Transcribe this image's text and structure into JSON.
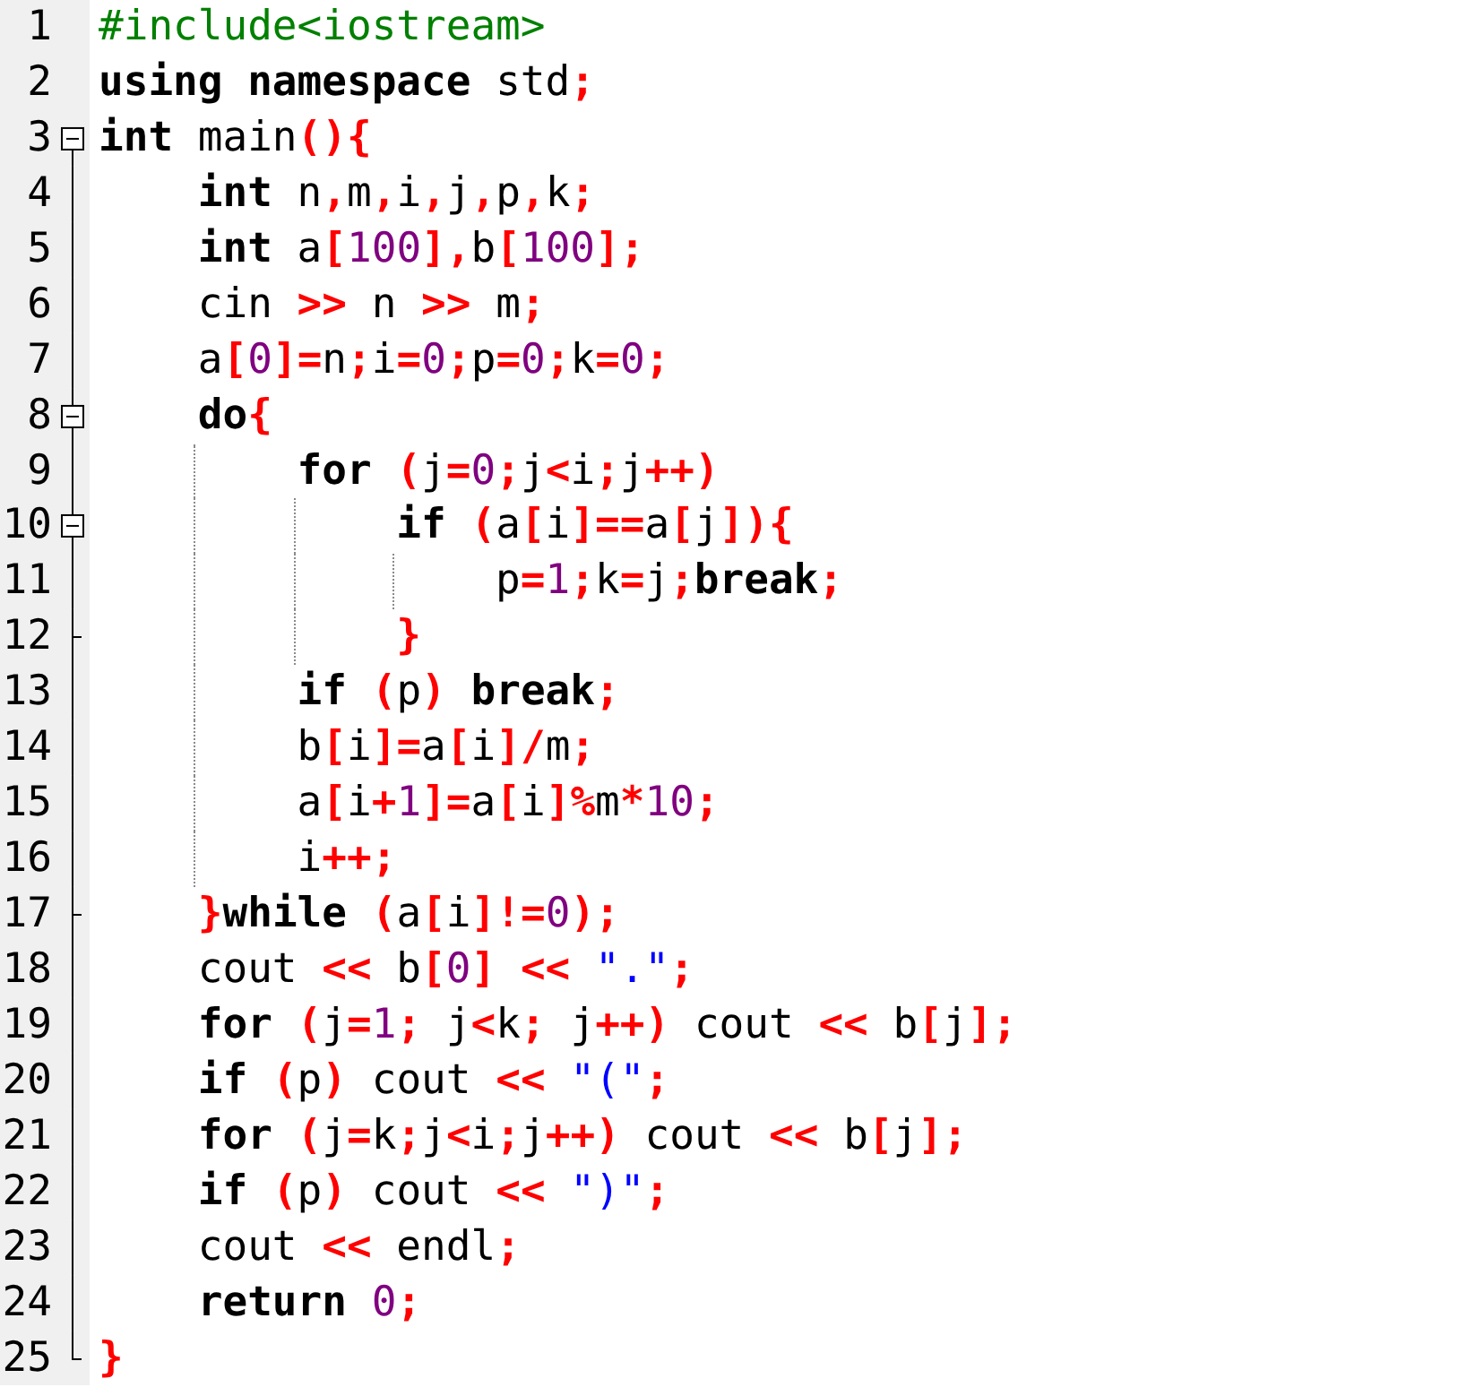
{
  "editor": {
    "lines": [
      {
        "number": "1",
        "kind": "plain",
        "tokens": [
          {
            "kind": "pre",
            "text": "#include<iostream>"
          }
        ]
      },
      {
        "number": "2",
        "kind": "plain",
        "tokens": [
          {
            "kind": "kw",
            "text": "using namespace"
          },
          {
            "kind": "plain",
            "text": " std"
          },
          {
            "kind": "op",
            "text": ";"
          }
        ]
      },
      {
        "number": "3",
        "kind": "open",
        "tokens": [
          {
            "kind": "kw",
            "text": "int"
          },
          {
            "kind": "plain",
            "text": " main"
          },
          {
            "kind": "op",
            "text": "(){"
          }
        ]
      },
      {
        "number": "4",
        "kind": "inner",
        "tokens": [
          {
            "kind": "kw",
            "text": "    int"
          },
          {
            "kind": "plain",
            "text": " n"
          },
          {
            "kind": "op",
            "text": ","
          },
          {
            "kind": "plain",
            "text": "m"
          },
          {
            "kind": "op",
            "text": ","
          },
          {
            "kind": "plain",
            "text": "i"
          },
          {
            "kind": "op",
            "text": ","
          },
          {
            "kind": "plain",
            "text": "j"
          },
          {
            "kind": "op",
            "text": ","
          },
          {
            "kind": "plain",
            "text": "p"
          },
          {
            "kind": "op",
            "text": ","
          },
          {
            "kind": "plain",
            "text": "k"
          },
          {
            "kind": "op",
            "text": ";"
          }
        ]
      },
      {
        "number": "5",
        "kind": "inner",
        "tokens": [
          {
            "kind": "kw",
            "text": "    int"
          },
          {
            "kind": "plain",
            "text": " a"
          },
          {
            "kind": "op",
            "text": "["
          },
          {
            "kind": "num",
            "text": "100"
          },
          {
            "kind": "op",
            "text": "],"
          },
          {
            "kind": "plain",
            "text": "b"
          },
          {
            "kind": "op",
            "text": "["
          },
          {
            "kind": "num",
            "text": "100"
          },
          {
            "kind": "op",
            "text": "];"
          }
        ]
      },
      {
        "number": "6",
        "kind": "inner",
        "tokens": [
          {
            "kind": "plain",
            "text": "    cin "
          },
          {
            "kind": "op",
            "text": ">>"
          },
          {
            "kind": "plain",
            "text": " n "
          },
          {
            "kind": "op",
            "text": ">>"
          },
          {
            "kind": "plain",
            "text": " m"
          },
          {
            "kind": "op",
            "text": ";"
          }
        ]
      },
      {
        "number": "7",
        "kind": "inner",
        "tokens": [
          {
            "kind": "plain",
            "text": "    a"
          },
          {
            "kind": "op",
            "text": "["
          },
          {
            "kind": "num",
            "text": "0"
          },
          {
            "kind": "op",
            "text": "]="
          },
          {
            "kind": "plain",
            "text": "n"
          },
          {
            "kind": "op",
            "text": ";"
          },
          {
            "kind": "plain",
            "text": "i"
          },
          {
            "kind": "op",
            "text": "="
          },
          {
            "kind": "num",
            "text": "0"
          },
          {
            "kind": "op",
            "text": ";"
          },
          {
            "kind": "plain",
            "text": "p"
          },
          {
            "kind": "op",
            "text": "="
          },
          {
            "kind": "num",
            "text": "0"
          },
          {
            "kind": "op",
            "text": ";"
          },
          {
            "kind": "plain",
            "text": "k"
          },
          {
            "kind": "op",
            "text": "="
          },
          {
            "kind": "num",
            "text": "0"
          },
          {
            "kind": "op",
            "text": ";"
          }
        ]
      },
      {
        "number": "8",
        "kind": "open",
        "tokens": [
          {
            "kind": "kw",
            "text": "    do"
          },
          {
            "kind": "op",
            "text": "{"
          }
        ]
      },
      {
        "number": "9",
        "kind": "inner",
        "tokens": [
          {
            "kind": "kw",
            "text": "        for"
          },
          {
            "kind": "op",
            "text": " ("
          },
          {
            "kind": "plain",
            "text": "j"
          },
          {
            "kind": "op",
            "text": "="
          },
          {
            "kind": "num",
            "text": "0"
          },
          {
            "kind": "op",
            "text": ";"
          },
          {
            "kind": "plain",
            "text": "j"
          },
          {
            "kind": "op",
            "text": "<"
          },
          {
            "kind": "plain",
            "text": "i"
          },
          {
            "kind": "op",
            "text": ";"
          },
          {
            "kind": "plain",
            "text": "j"
          },
          {
            "kind": "op",
            "text": "++)"
          }
        ]
      },
      {
        "number": "10",
        "kind": "open",
        "tokens": [
          {
            "kind": "kw",
            "text": "            if"
          },
          {
            "kind": "op",
            "text": " ("
          },
          {
            "kind": "plain",
            "text": "a"
          },
          {
            "kind": "op",
            "text": "["
          },
          {
            "kind": "plain",
            "text": "i"
          },
          {
            "kind": "op",
            "text": "]=="
          },
          {
            "kind": "plain",
            "text": "a"
          },
          {
            "kind": "op",
            "text": "["
          },
          {
            "kind": "plain",
            "text": "j"
          },
          {
            "kind": "op",
            "text": "]){"
          }
        ]
      },
      {
        "number": "11",
        "kind": "inner",
        "tokens": [
          {
            "kind": "plain",
            "text": "                p"
          },
          {
            "kind": "op",
            "text": "="
          },
          {
            "kind": "num",
            "text": "1"
          },
          {
            "kind": "op",
            "text": ";"
          },
          {
            "kind": "plain",
            "text": "k"
          },
          {
            "kind": "op",
            "text": "="
          },
          {
            "kind": "plain",
            "text": "j"
          },
          {
            "kind": "op",
            "text": ";"
          },
          {
            "kind": "kw",
            "text": "break"
          },
          {
            "kind": "op",
            "text": ";"
          }
        ]
      },
      {
        "number": "12",
        "kind": "end",
        "tokens": [
          {
            "kind": "op",
            "text": "            }"
          }
        ]
      },
      {
        "number": "13",
        "kind": "inner",
        "tokens": [
          {
            "kind": "kw",
            "text": "        if"
          },
          {
            "kind": "op",
            "text": " ("
          },
          {
            "kind": "plain",
            "text": "p"
          },
          {
            "kind": "op",
            "text": ")"
          },
          {
            "kind": "kw",
            "text": " break"
          },
          {
            "kind": "op",
            "text": ";"
          }
        ]
      },
      {
        "number": "14",
        "kind": "inner",
        "tokens": [
          {
            "kind": "plain",
            "text": "        b"
          },
          {
            "kind": "op",
            "text": "["
          },
          {
            "kind": "plain",
            "text": "i"
          },
          {
            "kind": "op",
            "text": "]="
          },
          {
            "kind": "plain",
            "text": "a"
          },
          {
            "kind": "op",
            "text": "["
          },
          {
            "kind": "plain",
            "text": "i"
          },
          {
            "kind": "op",
            "text": "]/"
          },
          {
            "kind": "plain",
            "text": "m"
          },
          {
            "kind": "op",
            "text": ";"
          }
        ]
      },
      {
        "number": "15",
        "kind": "inner",
        "tokens": [
          {
            "kind": "plain",
            "text": "        a"
          },
          {
            "kind": "op",
            "text": "["
          },
          {
            "kind": "plain",
            "text": "i"
          },
          {
            "kind": "op",
            "text": "+"
          },
          {
            "kind": "num",
            "text": "1"
          },
          {
            "kind": "op",
            "text": "]="
          },
          {
            "kind": "plain",
            "text": "a"
          },
          {
            "kind": "op",
            "text": "["
          },
          {
            "kind": "plain",
            "text": "i"
          },
          {
            "kind": "op",
            "text": "]%"
          },
          {
            "kind": "plain",
            "text": "m"
          },
          {
            "kind": "op",
            "text": "*"
          },
          {
            "kind": "num",
            "text": "10"
          },
          {
            "kind": "op",
            "text": ";"
          }
        ]
      },
      {
        "number": "16",
        "kind": "inner",
        "tokens": [
          {
            "kind": "plain",
            "text": "        i"
          },
          {
            "kind": "op",
            "text": "++;"
          }
        ]
      },
      {
        "number": "17",
        "kind": "end",
        "tokens": [
          {
            "kind": "op",
            "text": "    }"
          },
          {
            "kind": "kw",
            "text": "while"
          },
          {
            "kind": "op",
            "text": " ("
          },
          {
            "kind": "plain",
            "text": "a"
          },
          {
            "kind": "op",
            "text": "["
          },
          {
            "kind": "plain",
            "text": "i"
          },
          {
            "kind": "op",
            "text": "]!="
          },
          {
            "kind": "num",
            "text": "0"
          },
          {
            "kind": "op",
            "text": ");"
          }
        ]
      },
      {
        "number": "18",
        "kind": "inner",
        "tokens": [
          {
            "kind": "plain",
            "text": "    cout "
          },
          {
            "kind": "op",
            "text": "<<"
          },
          {
            "kind": "plain",
            "text": " b"
          },
          {
            "kind": "op",
            "text": "["
          },
          {
            "kind": "num",
            "text": "0"
          },
          {
            "kind": "op",
            "text": "] <<"
          },
          {
            "kind": "str",
            "text": " \".\""
          },
          {
            "kind": "op",
            "text": ";"
          }
        ]
      },
      {
        "number": "19",
        "kind": "inner",
        "tokens": [
          {
            "kind": "kw",
            "text": "    for"
          },
          {
            "kind": "op",
            "text": " ("
          },
          {
            "kind": "plain",
            "text": "j"
          },
          {
            "kind": "op",
            "text": "="
          },
          {
            "kind": "num",
            "text": "1"
          },
          {
            "kind": "op",
            "text": ";"
          },
          {
            "kind": "plain",
            "text": " j"
          },
          {
            "kind": "op",
            "text": "<"
          },
          {
            "kind": "plain",
            "text": "k"
          },
          {
            "kind": "op",
            "text": ";"
          },
          {
            "kind": "plain",
            "text": " j"
          },
          {
            "kind": "op",
            "text": "++)"
          },
          {
            "kind": "plain",
            "text": " cout "
          },
          {
            "kind": "op",
            "text": "<<"
          },
          {
            "kind": "plain",
            "text": " b"
          },
          {
            "kind": "op",
            "text": "["
          },
          {
            "kind": "plain",
            "text": "j"
          },
          {
            "kind": "op",
            "text": "];"
          }
        ]
      },
      {
        "number": "20",
        "kind": "inner",
        "tokens": [
          {
            "kind": "kw",
            "text": "    if"
          },
          {
            "kind": "op",
            "text": " ("
          },
          {
            "kind": "plain",
            "text": "p"
          },
          {
            "kind": "op",
            "text": ")"
          },
          {
            "kind": "plain",
            "text": " cout "
          },
          {
            "kind": "op",
            "text": "<<"
          },
          {
            "kind": "str",
            "text": " \"(\""
          },
          {
            "kind": "op",
            "text": ";"
          }
        ]
      },
      {
        "number": "21",
        "kind": "inner",
        "tokens": [
          {
            "kind": "kw",
            "text": "    for"
          },
          {
            "kind": "op",
            "text": " ("
          },
          {
            "kind": "plain",
            "text": "j"
          },
          {
            "kind": "op",
            "text": "="
          },
          {
            "kind": "plain",
            "text": "k"
          },
          {
            "kind": "op",
            "text": ";"
          },
          {
            "kind": "plain",
            "text": "j"
          },
          {
            "kind": "op",
            "text": "<"
          },
          {
            "kind": "plain",
            "text": "i"
          },
          {
            "kind": "op",
            "text": ";"
          },
          {
            "kind": "plain",
            "text": "j"
          },
          {
            "kind": "op",
            "text": "++)"
          },
          {
            "kind": "plain",
            "text": " cout "
          },
          {
            "kind": "op",
            "text": "<<"
          },
          {
            "kind": "plain",
            "text": " b"
          },
          {
            "kind": "op",
            "text": "["
          },
          {
            "kind": "plain",
            "text": "j"
          },
          {
            "kind": "op",
            "text": "];"
          }
        ]
      },
      {
        "number": "22",
        "kind": "inner",
        "tokens": [
          {
            "kind": "kw",
            "text": "    if"
          },
          {
            "kind": "op",
            "text": " ("
          },
          {
            "kind": "plain",
            "text": "p"
          },
          {
            "kind": "op",
            "text": ")"
          },
          {
            "kind": "plain",
            "text": " cout "
          },
          {
            "kind": "op",
            "text": "<<"
          },
          {
            "kind": "str",
            "text": " \")\""
          },
          {
            "kind": "op",
            "text": ";"
          }
        ]
      },
      {
        "number": "23",
        "kind": "inner",
        "tokens": [
          {
            "kind": "plain",
            "text": "    cout "
          },
          {
            "kind": "op",
            "text": "<<"
          },
          {
            "kind": "plain",
            "text": " endl"
          },
          {
            "kind": "op",
            "text": ";"
          }
        ]
      },
      {
        "number": "24",
        "kind": "inner",
        "tokens": [
          {
            "kind": "kw",
            "text": "    return"
          },
          {
            "kind": "num",
            "text": " 0"
          },
          {
            "kind": "op",
            "text": ";"
          }
        ]
      },
      {
        "number": "25",
        "kind": "last",
        "tokens": [
          {
            "kind": "op",
            "text": "}"
          }
        ]
      }
    ]
  }
}
